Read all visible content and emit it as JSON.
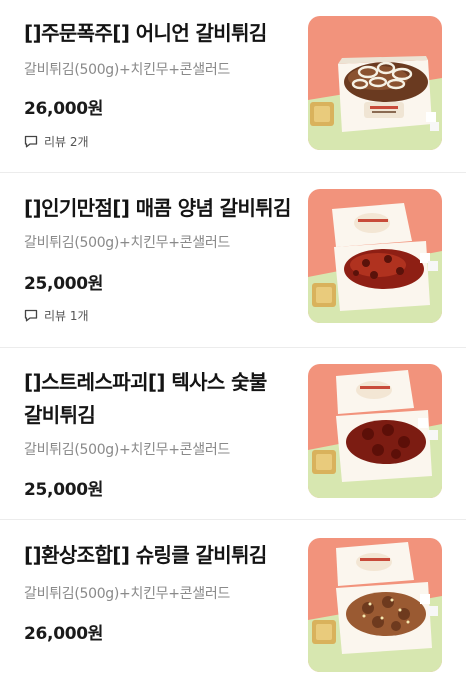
{
  "items": [
    {
      "name": "[]주문폭주[] 어니언 갈비튀김",
      "description": "갈비튀김(500g)+치킨무+콘샐러드",
      "price": "26,000원",
      "review_label": "리뷰 2개",
      "topping": "onion"
    },
    {
      "name": "[]인기만점[] 매콤 양념 갈비튀김",
      "description": "갈비튀김(500g)+치킨무+콘샐러드",
      "price": "25,000원",
      "review_label": "리뷰 1개",
      "topping": "spicy"
    },
    {
      "name_line1": "[]스트레스파괴[] 텍사스 숯불",
      "name_line2": "갈비튀김",
      "description": "갈비튀김(500g)+치킨무+콘샐러드",
      "price": "25,000원",
      "topping": "bbq"
    },
    {
      "name": "[]환상조합[] 슈링클 갈비튀김",
      "description": "갈비튀김(500g)+치킨무+콘샐러드",
      "price": "26,000원",
      "topping": "sprinkle"
    }
  ],
  "icons": {
    "review": "speech-bubble-icon"
  },
  "colors": {
    "photo_bg_top": "#f2937c",
    "photo_bg_bottom": "#d7e7b0"
  }
}
